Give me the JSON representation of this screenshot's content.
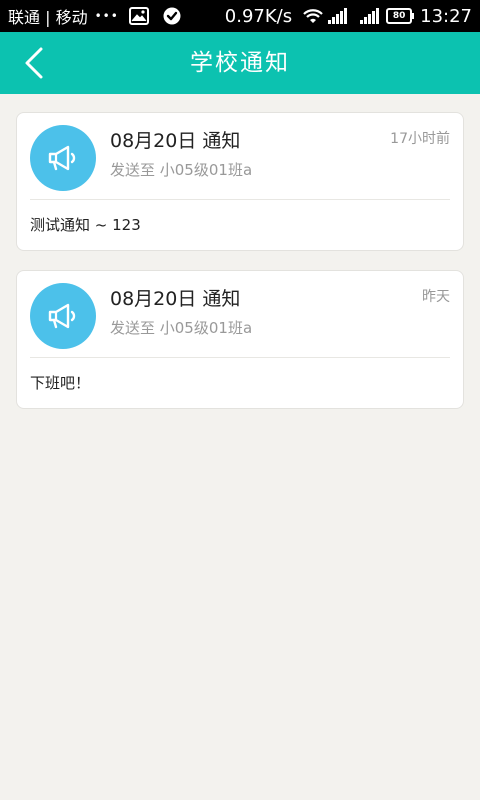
{
  "status_bar": {
    "carrier": "联通 | 移动",
    "dots": "•••",
    "net_speed": "0.97K/s",
    "battery": "80",
    "time": "13:27",
    "icons": [
      "image-icon",
      "check-circle-icon",
      "wifi-icon",
      "signal-icon",
      "signal-icon",
      "battery-icon"
    ]
  },
  "header": {
    "title": "学校通知",
    "back_icon": "chevron-left-icon",
    "background": "#0cc2b0"
  },
  "notices": [
    {
      "title": "08月20日 通知",
      "time": "17小时前",
      "target": "发送至 小05级01班a",
      "body": "测试通知 ~ 123",
      "icon": "megaphone-icon",
      "icon_bg": "#4cc1ea"
    },
    {
      "title": "08月20日 通知",
      "time": "昨天",
      "target": "发送至 小05级01班a",
      "body": "下班吧！",
      "icon": "megaphone-icon",
      "icon_bg": "#4cc1ea"
    }
  ]
}
